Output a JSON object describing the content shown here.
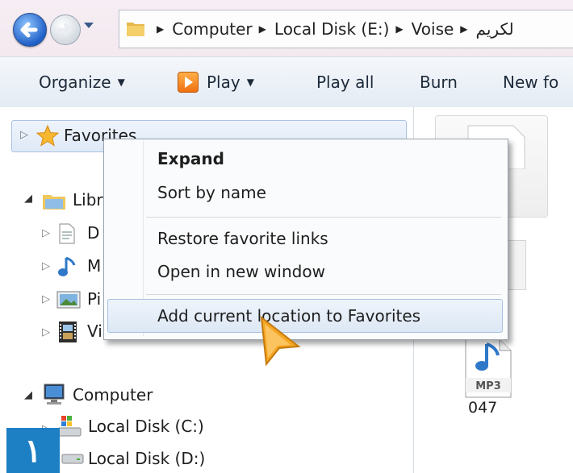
{
  "address_bar": {
    "breadcrumbs": [
      "Computer",
      "Local Disk (E:)",
      "Voise",
      "لكريم"
    ]
  },
  "toolbar": {
    "organize": "Organize",
    "play": "Play",
    "play_all": "Play all",
    "burn": "Burn",
    "new_folder": "New fo"
  },
  "nav": {
    "favorites": "Favorites",
    "libraries": "Libr",
    "documents": "D",
    "music": "M",
    "pictures": "Pi",
    "videos": "Vi",
    "computer": "Computer",
    "local_c": "Local Disk (C:)",
    "local_d": "Local Disk (D:)"
  },
  "context_menu": {
    "items": [
      "Expand",
      "Sort by name",
      "Restore favorite links",
      "Open in new window",
      "Add current location to Favorites"
    ]
  },
  "files": {
    "mp3_badge": "MP3",
    "mp3_name": "047"
  },
  "step_badge": "١",
  "colors": {
    "badge": "#1d7fc4",
    "highlight_border": "#a7c1e2",
    "cursor": "#f5a623"
  }
}
